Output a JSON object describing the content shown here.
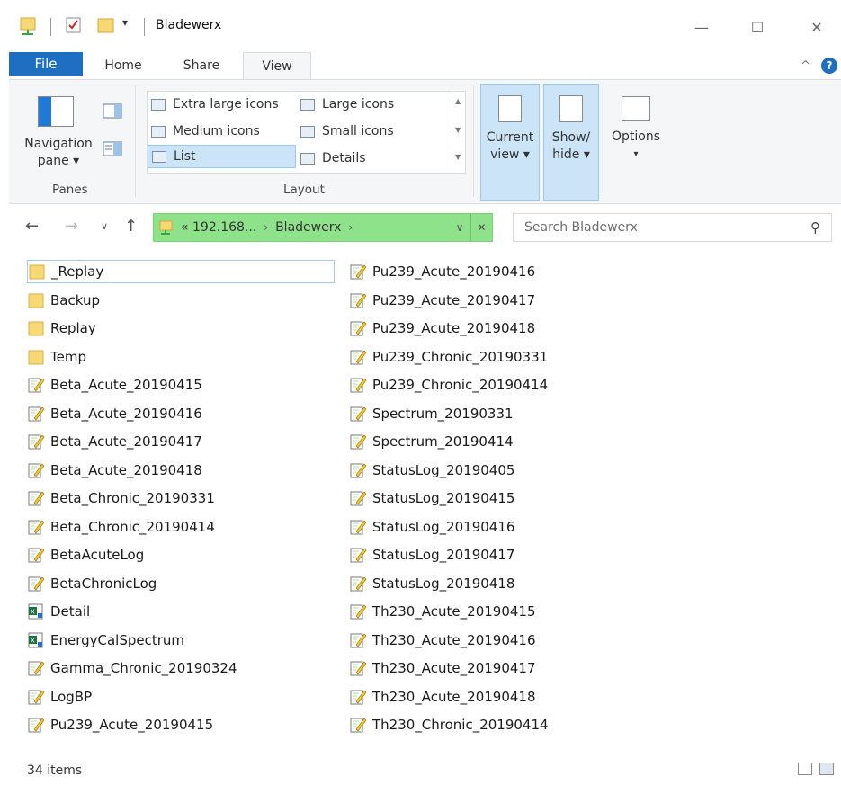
{
  "window": {
    "title": "Bladewerx"
  },
  "ribbon": {
    "tabs": [
      "File",
      "Home",
      "Share",
      "View"
    ],
    "panes": {
      "nav_pane": "Navigation",
      "nav_pane2": "pane ▾",
      "group": "Panes"
    },
    "layout": {
      "group": "Layout",
      "options": [
        "Extra large icons",
        "Large icons",
        "Medium icons",
        "Small icons",
        "List",
        "Details"
      ],
      "selected": "List"
    },
    "current_view": {
      "line1": "Current",
      "line2": "view ▾"
    },
    "show_hide": {
      "line1": "Show/",
      "line2": "hide ▾"
    },
    "options": {
      "line1": "Options",
      "line2": "▾"
    }
  },
  "address": {
    "crumbs": [
      "« 192.168...",
      "Bladewerx"
    ],
    "search_placeholder": "Search Bladewerx"
  },
  "files": [
    {
      "name": "_Replay",
      "type": "folder"
    },
    {
      "name": "Backup",
      "type": "folder"
    },
    {
      "name": "Replay",
      "type": "folder"
    },
    {
      "name": "Temp",
      "type": "folder"
    },
    {
      "name": "Beta_Acute_20190415",
      "type": "text"
    },
    {
      "name": "Beta_Acute_20190416",
      "type": "text"
    },
    {
      "name": "Beta_Acute_20190417",
      "type": "text"
    },
    {
      "name": "Beta_Acute_20190418",
      "type": "text"
    },
    {
      "name": "Beta_Chronic_20190331",
      "type": "text"
    },
    {
      "name": "Beta_Chronic_20190414",
      "type": "text"
    },
    {
      "name": "BetaAcuteLog",
      "type": "text"
    },
    {
      "name": "BetaChronicLog",
      "type": "text"
    },
    {
      "name": "Detail",
      "type": "excel"
    },
    {
      "name": "EnergyCalSpectrum",
      "type": "excel"
    },
    {
      "name": "Gamma_Chronic_20190324",
      "type": "text"
    },
    {
      "name": "LogBP",
      "type": "text"
    },
    {
      "name": "Pu239_Acute_20190415",
      "type": "text"
    },
    {
      "name": "Pu239_Acute_20190416",
      "type": "text"
    },
    {
      "name": "Pu239_Acute_20190417",
      "type": "text"
    },
    {
      "name": "Pu239_Acute_20190418",
      "type": "text"
    },
    {
      "name": "Pu239_Chronic_20190331",
      "type": "text"
    },
    {
      "name": "Pu239_Chronic_20190414",
      "type": "text"
    },
    {
      "name": "Spectrum_20190331",
      "type": "text"
    },
    {
      "name": "Spectrum_20190414",
      "type": "text"
    },
    {
      "name": "StatusLog_20190405",
      "type": "text"
    },
    {
      "name": "StatusLog_20190415",
      "type": "text"
    },
    {
      "name": "StatusLog_20190416",
      "type": "text"
    },
    {
      "name": "StatusLog_20190417",
      "type": "text"
    },
    {
      "name": "StatusLog_20190418",
      "type": "text"
    },
    {
      "name": "Th230_Acute_20190415",
      "type": "text"
    },
    {
      "name": "Th230_Acute_20190416",
      "type": "text"
    },
    {
      "name": "Th230_Acute_20190417",
      "type": "text"
    },
    {
      "name": "Th230_Acute_20190418",
      "type": "text"
    },
    {
      "name": "Th230_Chronic_20190414",
      "type": "text"
    }
  ],
  "status": {
    "count": "34 items"
  },
  "colors": {
    "accent": "#1e6fc1",
    "address_highlight": "#8ee28a",
    "selection": "#cce4f7"
  }
}
